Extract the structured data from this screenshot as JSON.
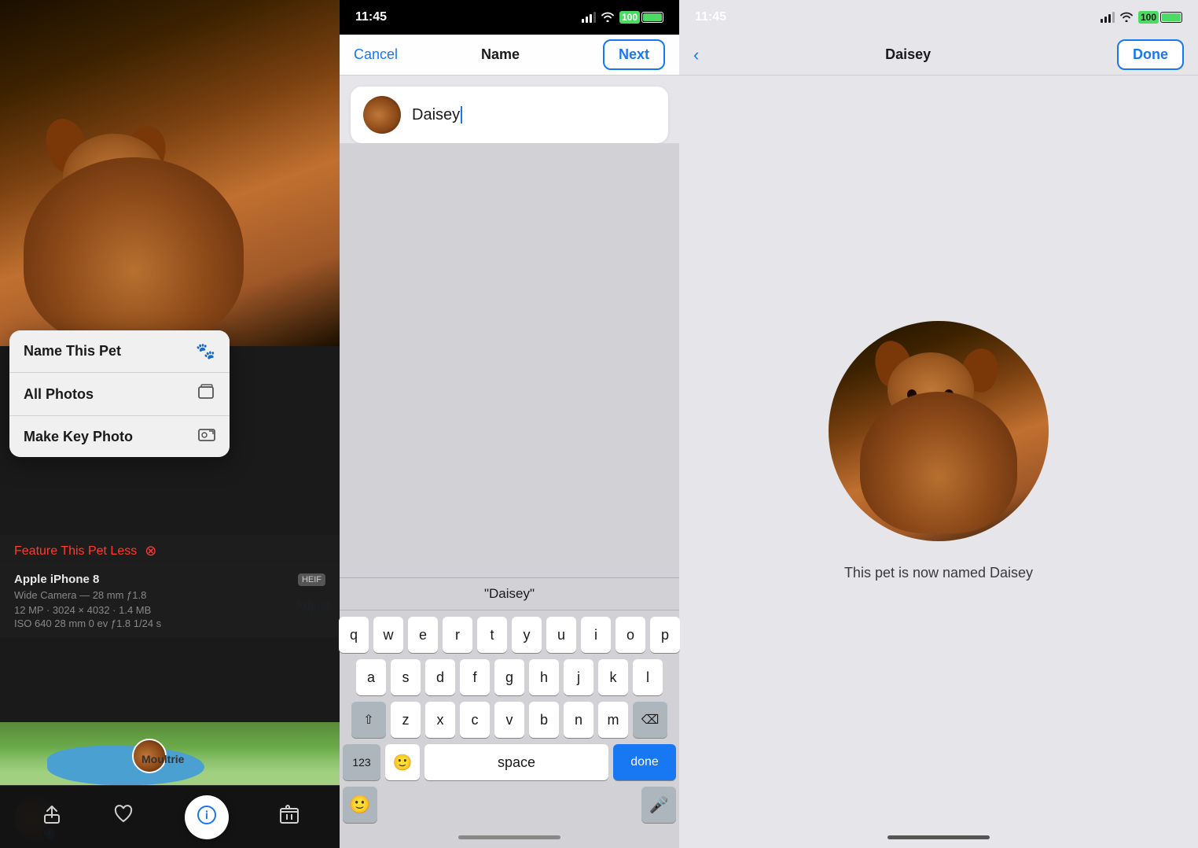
{
  "panel1": {
    "popup": {
      "items": [
        {
          "label": "Name This Pet",
          "icon": "🐾"
        },
        {
          "label": "All Photos",
          "icon": "⬛"
        },
        {
          "label": "Make Key Photo",
          "icon": "🖼"
        }
      ]
    },
    "feature_pet_less": "Feature This Pet Less",
    "device": {
      "name": "Apple iPhone 8",
      "badge": "HEIF",
      "camera": "Wide Camera — 28 mm ƒ1.8",
      "specs": "12 MP · 3024 × 4032 · 1.4 MB",
      "exif": "ISO 640    28 mm    0 ev    ƒ1.8    1/24 s"
    },
    "map_label": "Moultrie",
    "adjust": "Adjust"
  },
  "panel2": {
    "status": {
      "time": "11:45",
      "battery": "100"
    },
    "nav": {
      "cancel": "Cancel",
      "title": "Name",
      "next": "Next"
    },
    "input": {
      "value": "Daisey"
    },
    "suggestion": "\"Daisey\"",
    "keyboard": {
      "row1": [
        "q",
        "w",
        "e",
        "r",
        "t",
        "y",
        "u",
        "i",
        "o",
        "p"
      ],
      "row2": [
        "a",
        "s",
        "d",
        "f",
        "g",
        "h",
        "j",
        "k",
        "l"
      ],
      "row3": [
        "z",
        "x",
        "c",
        "v",
        "b",
        "n",
        "m"
      ],
      "numbers": "123",
      "space": "space",
      "done": "done"
    }
  },
  "panel3": {
    "status": {
      "time": "11:45",
      "battery": "100"
    },
    "nav": {
      "title": "Daisey",
      "done": "Done"
    },
    "caption": "This pet is now named Daisey"
  }
}
